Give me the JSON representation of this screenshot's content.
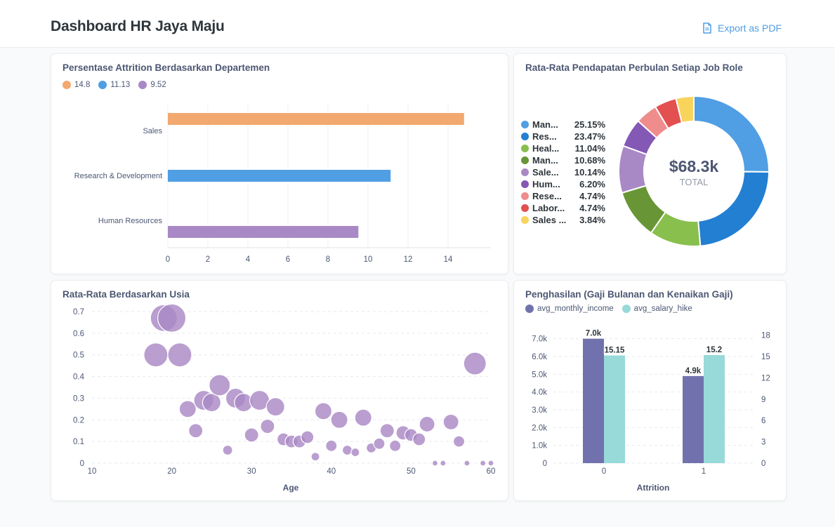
{
  "header": {
    "title": "Dashboard HR Jaya Maju",
    "export_label": "Export as PDF"
  },
  "colors": {
    "accent": "#509ee3",
    "orange": "#f2a86f",
    "blue": "#509ee3",
    "purple": "#a989c5"
  },
  "cards": {
    "attrition": {
      "title": "Persentase Attrition Berdasarkan Departemen",
      "chart_data": {
        "type": "bar",
        "orientation": "horizontal",
        "categories": [
          "Sales",
          "Research & Development",
          "Human Resources"
        ],
        "values": [
          14.8,
          11.13,
          9.52
        ],
        "legend": [
          "14.8",
          "11.13",
          "9.52"
        ],
        "colors": [
          "#f2a86f",
          "#509ee3",
          "#a989c5"
        ],
        "xlim": [
          0,
          16
        ],
        "xticks": [
          0,
          2,
          4,
          6,
          8,
          10,
          12,
          14
        ],
        "legend_position": "top-left"
      }
    },
    "income_by_role": {
      "title": "Rata-Rata Pendapatan Perbulan Setiap Job Role",
      "chart_data": {
        "type": "pie",
        "donut": true,
        "total_value": "$68.3k",
        "total_label": "TOTAL",
        "slices": [
          {
            "label": "Man...",
            "pct": "25.15%",
            "value": 25.15,
            "color": "#509ee3"
          },
          {
            "label": "Res...",
            "pct": "23.47%",
            "value": 23.47,
            "color": "#227fd2"
          },
          {
            "label": "Heal...",
            "pct": "11.04%",
            "value": 11.04,
            "color": "#88bf4d"
          },
          {
            "label": "Man...",
            "pct": "10.68%",
            "value": 10.68,
            "color": "#689636"
          },
          {
            "label": "Sale...",
            "pct": "10.14%",
            "value": 10.14,
            "color": "#a989c5"
          },
          {
            "label": "Hum...",
            "pct": "6.20%",
            "value": 6.2,
            "color": "#8458b5"
          },
          {
            "label": "Rese...",
            "pct": "4.74%",
            "value": 4.74,
            "color": "#ef8c8c"
          },
          {
            "label": "Labor...",
            "pct": "4.74%",
            "value": 4.74,
            "color": "#e35050"
          },
          {
            "label": "Sales ...",
            "pct": "3.84%",
            "value": 3.84,
            "color": "#f9d45c"
          }
        ],
        "legend_position": "left"
      }
    },
    "age": {
      "title": "Rata-Rata Berdasarkan Usia",
      "chart_data": {
        "type": "scatter",
        "bubble": true,
        "xlabel": "Age",
        "xlim": [
          10,
          60
        ],
        "ylim": [
          0,
          0.7
        ],
        "xticks": [
          10,
          20,
          30,
          40,
          50,
          60
        ],
        "yticks": [
          "0",
          "0.1",
          "0.2",
          "0.3",
          "0.4",
          "0.5",
          "0.6",
          "0.7"
        ],
        "color": "#a989c5",
        "points": [
          {
            "x": 18,
            "y": 0.5,
            "size": 17
          },
          {
            "x": 19,
            "y": 0.67,
            "size": 19
          },
          {
            "x": 20,
            "y": 0.67,
            "size": 20
          },
          {
            "x": 21,
            "y": 0.5,
            "size": 17
          },
          {
            "x": 22,
            "y": 0.25,
            "size": 12
          },
          {
            "x": 23,
            "y": 0.15,
            "size": 10
          },
          {
            "x": 24,
            "y": 0.29,
            "size": 14
          },
          {
            "x": 25,
            "y": 0.28,
            "size": 13
          },
          {
            "x": 26,
            "y": 0.36,
            "size": 15
          },
          {
            "x": 27,
            "y": 0.06,
            "size": 7
          },
          {
            "x": 28,
            "y": 0.3,
            "size": 14
          },
          {
            "x": 29,
            "y": 0.28,
            "size": 13
          },
          {
            "x": 30,
            "y": 0.13,
            "size": 10
          },
          {
            "x": 31,
            "y": 0.29,
            "size": 14
          },
          {
            "x": 32,
            "y": 0.17,
            "size": 10
          },
          {
            "x": 33,
            "y": 0.26,
            "size": 13
          },
          {
            "x": 34,
            "y": 0.11,
            "size": 9
          },
          {
            "x": 35,
            "y": 0.1,
            "size": 9
          },
          {
            "x": 36,
            "y": 0.1,
            "size": 9
          },
          {
            "x": 37,
            "y": 0.12,
            "size": 9
          },
          {
            "x": 38,
            "y": 0.03,
            "size": 6
          },
          {
            "x": 39,
            "y": 0.24,
            "size": 12
          },
          {
            "x": 40,
            "y": 0.08,
            "size": 8
          },
          {
            "x": 41,
            "y": 0.2,
            "size": 12
          },
          {
            "x": 42,
            "y": 0.06,
            "size": 7
          },
          {
            "x": 43,
            "y": 0.05,
            "size": 6
          },
          {
            "x": 44,
            "y": 0.21,
            "size": 12
          },
          {
            "x": 45,
            "y": 0.07,
            "size": 7
          },
          {
            "x": 46,
            "y": 0.09,
            "size": 8
          },
          {
            "x": 47,
            "y": 0.15,
            "size": 10
          },
          {
            "x": 48,
            "y": 0.08,
            "size": 8
          },
          {
            "x": 49,
            "y": 0.14,
            "size": 10
          },
          {
            "x": 50,
            "y": 0.13,
            "size": 9
          },
          {
            "x": 51,
            "y": 0.11,
            "size": 9
          },
          {
            "x": 52,
            "y": 0.18,
            "size": 11
          },
          {
            "x": 53,
            "y": 0,
            "size": 4
          },
          {
            "x": 54,
            "y": 0,
            "size": 4
          },
          {
            "x": 55,
            "y": 0.19,
            "size": 11
          },
          {
            "x": 56,
            "y": 0.1,
            "size": 8
          },
          {
            "x": 57,
            "y": 0,
            "size": 4
          },
          {
            "x": 58,
            "y": 0.46,
            "size": 16
          },
          {
            "x": 59,
            "y": 0,
            "size": 4
          },
          {
            "x": 60,
            "y": 0,
            "size": 4
          }
        ]
      }
    },
    "income": {
      "title": "Penghasilan (Gaji Bulanan dan Kenaikan Gaji)",
      "chart_data": {
        "type": "bar",
        "xlabel": "Attrition",
        "categories": [
          "0",
          "1"
        ],
        "series": [
          {
            "name": "avg_monthly_income",
            "values": [
              7000,
              4900
            ],
            "labels": [
              "7.0k",
              "4.9k"
            ],
            "color": "#7172ad",
            "axis": "left"
          },
          {
            "name": "avg_salary_hike",
            "values": [
              15.15,
              15.2
            ],
            "labels": [
              "15.15",
              "15.2"
            ],
            "color": "#98d9d9",
            "axis": "right"
          }
        ],
        "ylim_left": [
          0,
          7500
        ],
        "ylim_right": [
          0,
          18.75
        ],
        "yticks_left": [
          "0",
          "1.0k",
          "2.0k",
          "3.0k",
          "4.0k",
          "5.0k",
          "6.0k",
          "7.0k"
        ],
        "yticks_right": [
          "0",
          "3",
          "6",
          "9",
          "12",
          "15",
          "18"
        ],
        "legend_position": "top-left"
      }
    }
  }
}
